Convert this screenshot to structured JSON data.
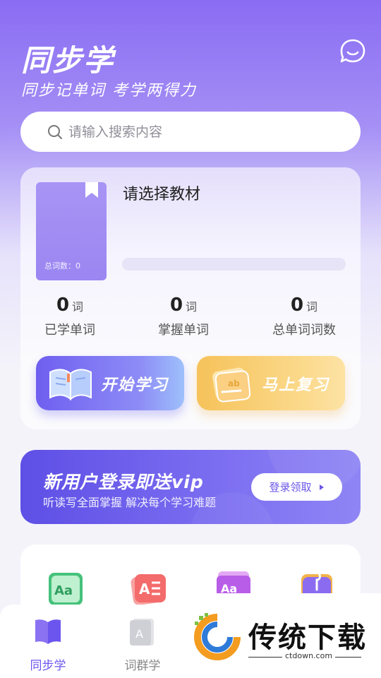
{
  "header": {
    "title": "同步学",
    "subtitle": "同步记单词 考学两得力"
  },
  "search": {
    "placeholder": "请输入搜索内容"
  },
  "textbook": {
    "prompt": "请选择教材",
    "total_words_label": "总词数：0",
    "progress": 0
  },
  "stats": [
    {
      "value": "0",
      "unit": "词",
      "label": "已学单词"
    },
    {
      "value": "0",
      "unit": "词",
      "label": "掌握单词"
    },
    {
      "value": "0",
      "unit": "词",
      "label": "总单词词数"
    }
  ],
  "actions": {
    "start_label": "开始学习",
    "review_label": "马上复习"
  },
  "vip_banner": {
    "title": "新用户登录即送vip",
    "subtitle": "听读写全面掌握 解决每个学习难题",
    "button_label": "登录领取"
  },
  "features": [
    {
      "icon": "aa-card-icon",
      "color": "#45c27b"
    },
    {
      "icon": "a-list-card-icon",
      "color": "#f46b6b"
    },
    {
      "icon": "aa-stack-icon",
      "color": "#b85de8"
    },
    {
      "icon": "clip-folder-icon",
      "color": "#8b6cf0"
    }
  ],
  "tabbar": {
    "items": [
      {
        "label": "同步学",
        "active": true
      },
      {
        "label": "词群学",
        "active": false
      }
    ]
  },
  "watermark": {
    "text": "传统下载",
    "url": "ctdown.com"
  },
  "colors": {
    "accent": "#6b55ee",
    "review": "#f6c25a"
  }
}
